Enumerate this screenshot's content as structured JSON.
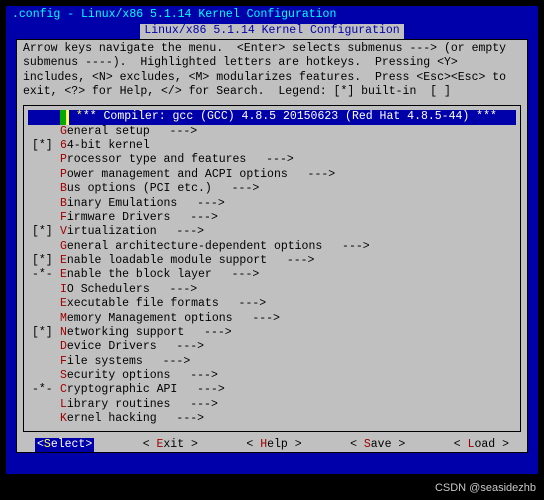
{
  "window_title": ".config - Linux/x86 5.1.14 Kernel Configuration",
  "dialog_title": " Linux/x86 5.1.14 Kernel Configuration ",
  "help_text": "Arrow keys navigate the menu.  <Enter> selects submenus ---> (or empty submenus ----).  Highlighted letters are hotkeys.  Pressing <Y> includes, <N> excludes, <M> modularizes features.  Press <Esc><Esc> to exit, <?> for Help, </> for Search.  Legend: [*] built-in  [ ]",
  "menu": {
    "items": [
      {
        "mark": "   ",
        "hot": "*",
        "text": "** Compiler: gcc (GCC) 4.8.5 20150623 (Red Hat 4.8.5-44) ***",
        "arrow": "",
        "selected": true
      },
      {
        "mark": "   ",
        "hot": "G",
        "text": "eneral setup",
        "arrow": "--->"
      },
      {
        "mark": "[*]",
        "hot": "6",
        "text": "4-bit kernel",
        "arrow": ""
      },
      {
        "mark": "   ",
        "hot": "P",
        "text": "rocessor type and features",
        "arrow": "--->"
      },
      {
        "mark": "   ",
        "hot": "P",
        "text": "ower management and ACPI options",
        "arrow": "--->"
      },
      {
        "mark": "   ",
        "hot": "B",
        "text": "us options (PCI etc.)",
        "arrow": "--->"
      },
      {
        "mark": "   ",
        "hot": "B",
        "text": "inary Emulations",
        "arrow": "--->"
      },
      {
        "mark": "   ",
        "hot": "F",
        "text": "irmware Drivers",
        "arrow": "--->"
      },
      {
        "mark": "[*]",
        "hot": "V",
        "text": "irtualization",
        "arrow": "--->"
      },
      {
        "mark": "   ",
        "hot": "G",
        "text": "eneral architecture-dependent options",
        "arrow": "--->"
      },
      {
        "mark": "[*]",
        "hot": "E",
        "text": "nable loadable module support",
        "arrow": "--->"
      },
      {
        "mark": "-*-",
        "hot": "E",
        "text": "nable the block layer",
        "arrow": "--->"
      },
      {
        "mark": "   ",
        "hot": "I",
        "text": "O Schedulers",
        "arrow": "--->"
      },
      {
        "mark": "   ",
        "hot": "E",
        "text": "xecutable file formats",
        "arrow": "--->"
      },
      {
        "mark": "   ",
        "hot": "M",
        "text": "emory Management options",
        "arrow": "--->"
      },
      {
        "mark": "[*]",
        "hot": "N",
        "text": "etworking support",
        "arrow": "--->"
      },
      {
        "mark": "   ",
        "hot": "D",
        "text": "evice Drivers",
        "arrow": "--->"
      },
      {
        "mark": "   ",
        "hot": "F",
        "text": "ile systems",
        "arrow": "--->"
      },
      {
        "mark": "   ",
        "hot": "S",
        "text": "ecurity options",
        "arrow": "--->"
      },
      {
        "mark": "-*-",
        "hot": "C",
        "text": "ryptographic API",
        "arrow": "--->"
      },
      {
        "mark": "   ",
        "hot": "L",
        "text": "ibrary routines",
        "arrow": "--->"
      },
      {
        "mark": "   ",
        "hot": "K",
        "text": "ernel hacking",
        "arrow": "--->"
      }
    ]
  },
  "buttons": [
    {
      "pre": "<",
      "hot": "S",
      "rest": "elect>",
      "selected": true
    },
    {
      "pre": "< ",
      "hot": "E",
      "rest": "xit >",
      "selected": false
    },
    {
      "pre": "< ",
      "hot": "H",
      "rest": "elp >",
      "selected": false
    },
    {
      "pre": "< ",
      "hot": "S",
      "rest": "ave >",
      "selected": false
    },
    {
      "pre": "< ",
      "hot": "L",
      "rest": "oad >",
      "selected": false
    }
  ],
  "watermark": "CSDN @seasidezhb"
}
